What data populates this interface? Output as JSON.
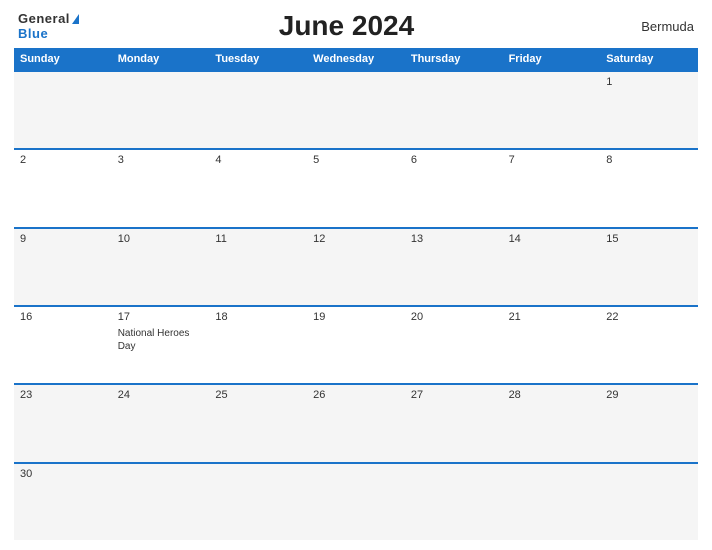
{
  "header": {
    "logo_general": "General",
    "logo_blue": "Blue",
    "title": "June 2024",
    "region": "Bermuda"
  },
  "days": [
    "Sunday",
    "Monday",
    "Tuesday",
    "Wednesday",
    "Thursday",
    "Friday",
    "Saturday"
  ],
  "weeks": [
    {
      "cells": [
        {
          "date": "",
          "empty": true
        },
        {
          "date": "",
          "empty": true
        },
        {
          "date": "",
          "empty": true
        },
        {
          "date": "",
          "empty": true
        },
        {
          "date": "",
          "empty": true
        },
        {
          "date": "",
          "empty": true
        },
        {
          "date": "1",
          "empty": false,
          "event": ""
        }
      ]
    },
    {
      "cells": [
        {
          "date": "2",
          "empty": false,
          "event": ""
        },
        {
          "date": "3",
          "empty": false,
          "event": ""
        },
        {
          "date": "4",
          "empty": false,
          "event": ""
        },
        {
          "date": "5",
          "empty": false,
          "event": ""
        },
        {
          "date": "6",
          "empty": false,
          "event": ""
        },
        {
          "date": "7",
          "empty": false,
          "event": ""
        },
        {
          "date": "8",
          "empty": false,
          "event": ""
        }
      ]
    },
    {
      "cells": [
        {
          "date": "9",
          "empty": false,
          "event": ""
        },
        {
          "date": "10",
          "empty": false,
          "event": ""
        },
        {
          "date": "11",
          "empty": false,
          "event": ""
        },
        {
          "date": "12",
          "empty": false,
          "event": ""
        },
        {
          "date": "13",
          "empty": false,
          "event": ""
        },
        {
          "date": "14",
          "empty": false,
          "event": ""
        },
        {
          "date": "15",
          "empty": false,
          "event": ""
        }
      ]
    },
    {
      "cells": [
        {
          "date": "16",
          "empty": false,
          "event": ""
        },
        {
          "date": "17",
          "empty": false,
          "event": "National Heroes Day"
        },
        {
          "date": "18",
          "empty": false,
          "event": ""
        },
        {
          "date": "19",
          "empty": false,
          "event": ""
        },
        {
          "date": "20",
          "empty": false,
          "event": ""
        },
        {
          "date": "21",
          "empty": false,
          "event": ""
        },
        {
          "date": "22",
          "empty": false,
          "event": ""
        }
      ]
    },
    {
      "cells": [
        {
          "date": "23",
          "empty": false,
          "event": ""
        },
        {
          "date": "24",
          "empty": false,
          "event": ""
        },
        {
          "date": "25",
          "empty": false,
          "event": ""
        },
        {
          "date": "26",
          "empty": false,
          "event": ""
        },
        {
          "date": "27",
          "empty": false,
          "event": ""
        },
        {
          "date": "28",
          "empty": false,
          "event": ""
        },
        {
          "date": "29",
          "empty": false,
          "event": ""
        }
      ]
    },
    {
      "cells": [
        {
          "date": "30",
          "empty": false,
          "event": ""
        },
        {
          "date": "",
          "empty": true
        },
        {
          "date": "",
          "empty": true
        },
        {
          "date": "",
          "empty": true
        },
        {
          "date": "",
          "empty": true
        },
        {
          "date": "",
          "empty": true
        },
        {
          "date": "",
          "empty": true
        }
      ]
    }
  ]
}
